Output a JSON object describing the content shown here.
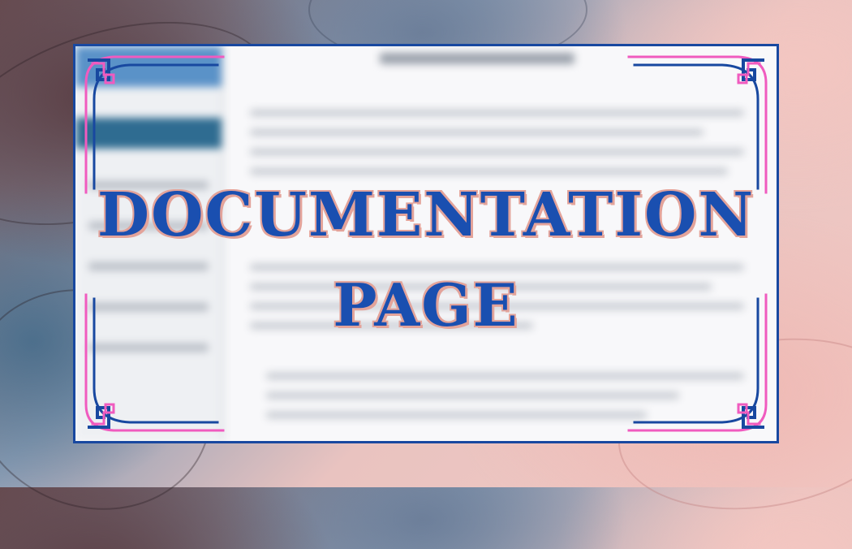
{
  "banner": {
    "title_line1": "DOCUMENTATION",
    "title_line2": "PAGE"
  },
  "colors": {
    "frame_blue": "#1848a0",
    "accent_pink": "#f05bbf",
    "title_blue": "#1a4fb0",
    "title_outline": "#e3a39a"
  },
  "decor": {
    "corner_ornament_icon": "chinese-fret-corner-icon",
    "background": "marbled-ink-texture"
  }
}
